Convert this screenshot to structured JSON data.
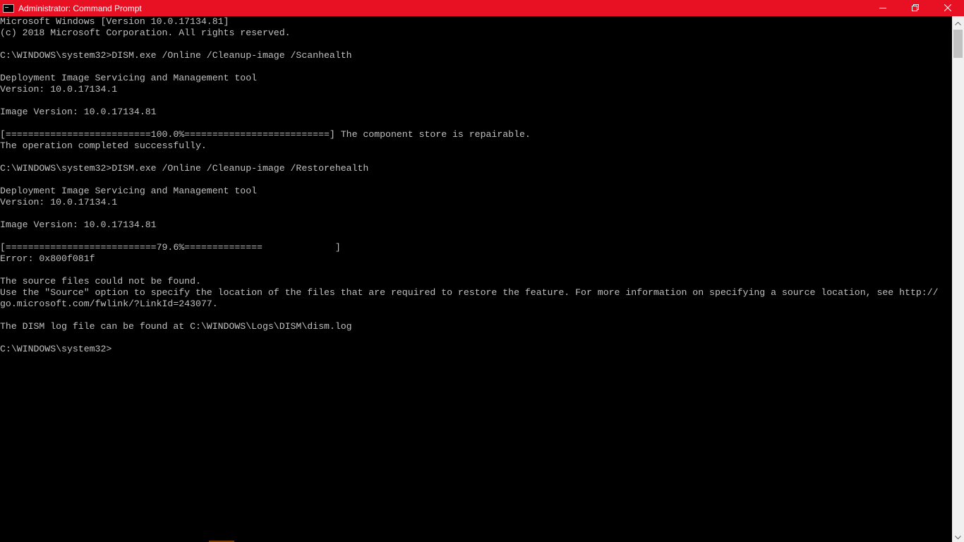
{
  "window": {
    "title": "Administrator: Command Prompt",
    "accent_color": "#e81123",
    "console_bg": "#000000",
    "console_fg": "#c0c0c0"
  },
  "controls": {
    "minimize_icon": "minimize-icon",
    "restore_icon": "restore-icon",
    "close_icon": "close-icon"
  },
  "console": {
    "lines": [
      "Microsoft Windows [Version 10.0.17134.81]",
      "(c) 2018 Microsoft Corporation. All rights reserved.",
      "",
      "C:\\WINDOWS\\system32>DISM.exe /Online /Cleanup-image /Scanhealth",
      "",
      "Deployment Image Servicing and Management tool",
      "Version: 10.0.17134.1",
      "",
      "Image Version: 10.0.17134.81",
      "",
      "[==========================100.0%==========================] The component store is repairable.",
      "The operation completed successfully.",
      "",
      "C:\\WINDOWS\\system32>DISM.exe /Online /Cleanup-image /Restorehealth",
      "",
      "Deployment Image Servicing and Management tool",
      "Version: 10.0.17134.1",
      "",
      "Image Version: 10.0.17134.81",
      "",
      "[===========================79.6%==============             ]",
      "Error: 0x800f081f",
      "",
      "The source files could not be found.",
      "Use the \"Source\" option to specify the location of the files that are required to restore the feature. For more information on specifying a source location, see http://",
      "go.microsoft.com/fwlink/?LinkId=243077.",
      "",
      "The DISM log file can be found at C:\\WINDOWS\\Logs\\DISM\\dism.log",
      "",
      "C:\\WINDOWS\\system32>"
    ]
  },
  "scrollbar": {
    "up_icon": "scroll-up-arrow-icon",
    "down_icon": "scroll-down-arrow-icon"
  }
}
